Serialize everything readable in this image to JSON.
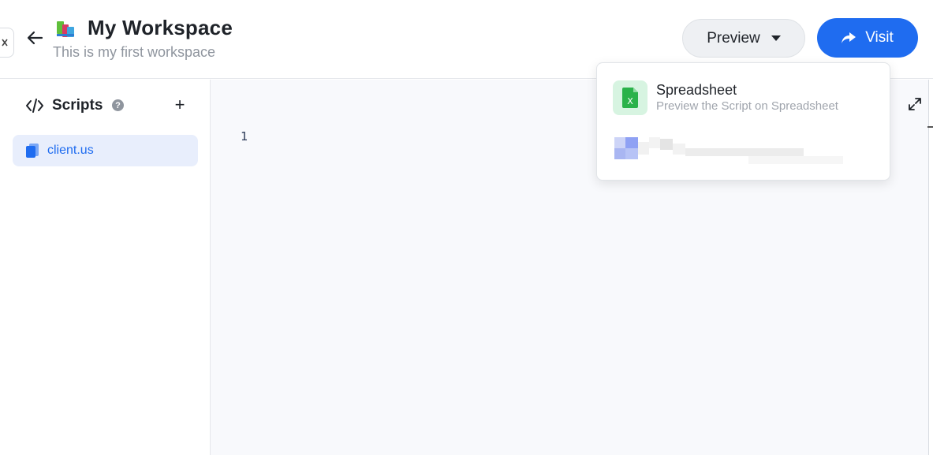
{
  "header": {
    "title": "My Workspace",
    "subtitle": "This is my first workspace",
    "preview_label": "Preview",
    "visit_label": "Visit"
  },
  "sidebar": {
    "section_title": "Scripts",
    "help_glyph": "?",
    "add_glyph": "+",
    "items": [
      {
        "label": "client.us",
        "icon": "file-icon",
        "selected": true
      }
    ]
  },
  "editor": {
    "line_numbers": [
      "1"
    ]
  },
  "preview_menu": {
    "items": [
      {
        "label": "Spreadsheet",
        "description": "Preview the Script on Spreadsheet",
        "icon": "spreadsheet-icon",
        "icon_letter": "X"
      }
    ]
  },
  "colors": {
    "accent": "#1f6cf0",
    "selected_bg": "#e8eefc",
    "sheet_green": "#2ab24a"
  }
}
